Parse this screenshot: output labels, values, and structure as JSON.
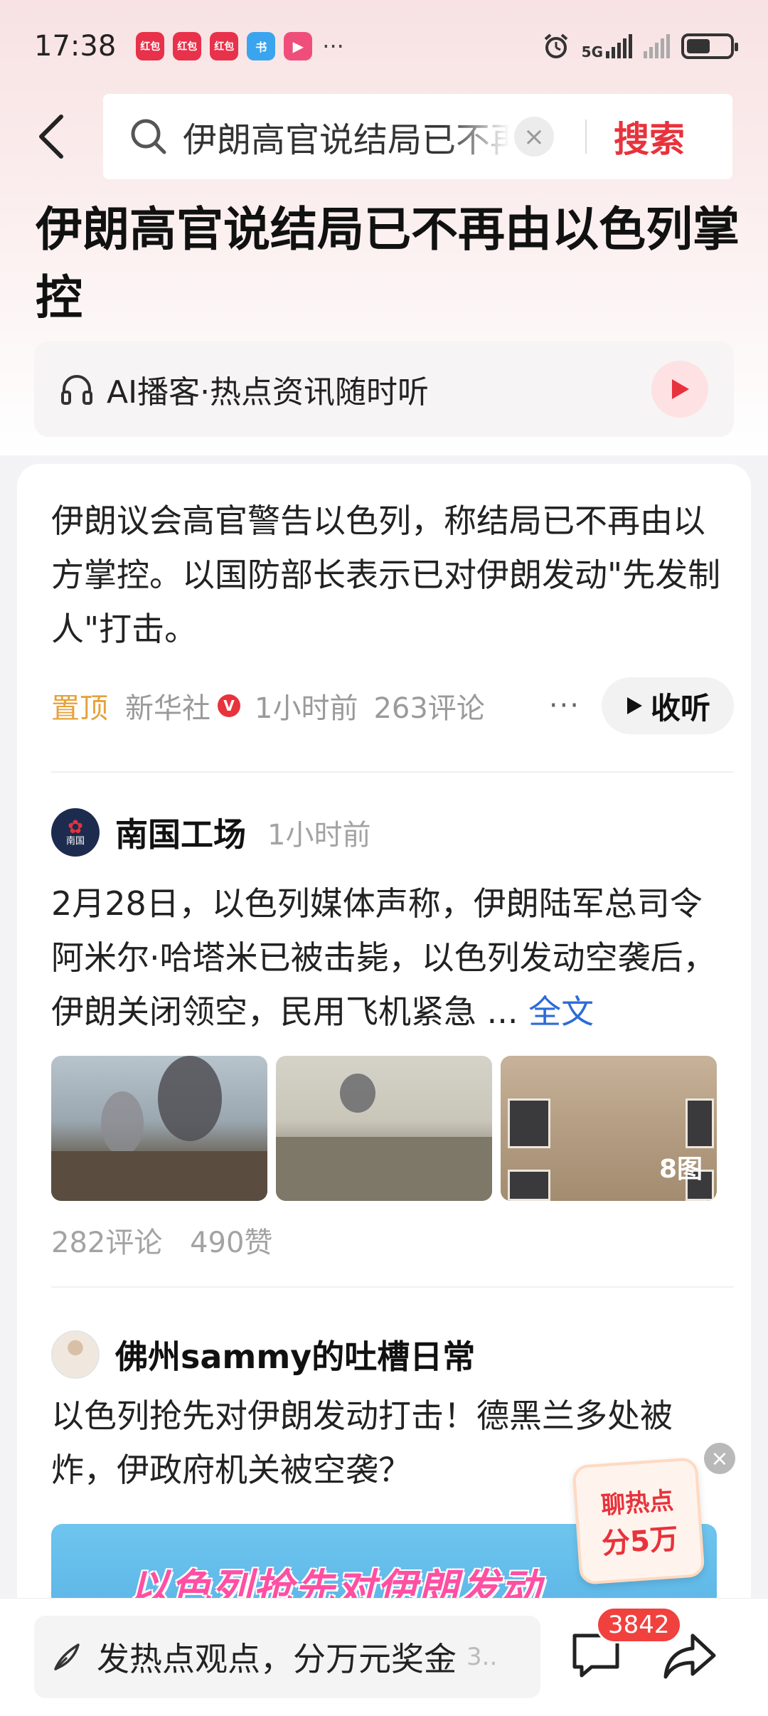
{
  "status_bar": {
    "time": "17:38",
    "app_badges": [
      "红包",
      "红包",
      "红包",
      "书",
      "▶"
    ],
    "more": "···",
    "network": "5G"
  },
  "search": {
    "query": "伊朗高官说结局已不再由以色列掌控",
    "clear_icon": "×",
    "button_label": "搜索"
  },
  "headline": "伊朗高官说结局已不再由以色列掌控",
  "podcast": {
    "label": "AI播客·热点资讯随时听"
  },
  "summary": {
    "text": "伊朗议会高官警告以色列，称结局已不再由以方掌控。以国防部长表示已对伊朗发动\"先发制人\"打击。",
    "pinned": "置顶",
    "source": "新华社",
    "verified_mark": "V",
    "time": "1小时前",
    "comments": "263评论",
    "more": "···",
    "listen_label": "收听"
  },
  "post1": {
    "author": "南国工场",
    "avatar_label": "南国",
    "time": "1小时前",
    "text": "2月28日，以色列媒体声称，伊朗陆军总司令阿米尔·哈塔米已被击毙，以色列发动空袭后，伊朗关闭领空，民用飞机紧急 ...",
    "full_text_link": "全文",
    "image_count": "8图",
    "comments": "282评论",
    "likes": "490赞"
  },
  "post2": {
    "author": "佛州sammy的吐槽日常",
    "text": "以色列抢先对伊朗发动打击！德黑兰多处被炸，伊政府机关被空袭？",
    "banner_text": "以色列抢先对伊朗发动"
  },
  "promo": {
    "line1": "聊热点",
    "line2": "分5万",
    "yuan": "¥",
    "close": "×"
  },
  "bottom_bar": {
    "comment_placeholder": "发热点观点，分万元奖金",
    "comment_more": "3..",
    "comment_count": "3842"
  },
  "colors": {
    "accent_red": "#e8323c",
    "pinned_orange": "#e6a23c",
    "link_blue": "#2d6bd8"
  }
}
